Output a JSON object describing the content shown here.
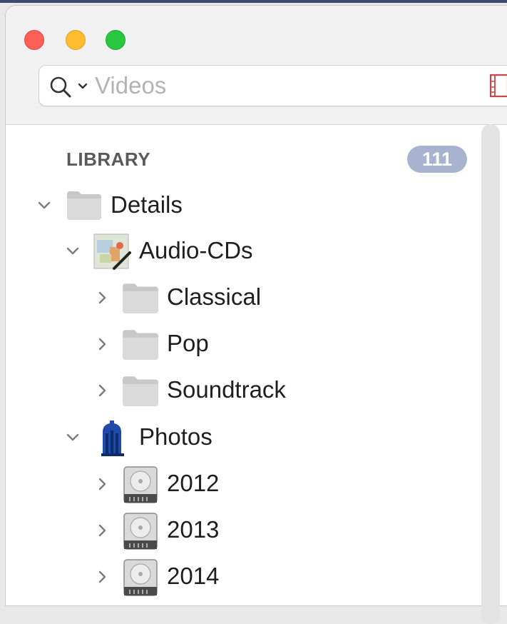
{
  "window": {
    "buttons": [
      "close",
      "minimize",
      "zoom"
    ]
  },
  "search": {
    "placeholder": "Videos",
    "icon": "search-icon",
    "scope_icon": "chevron-down-icon",
    "trailing_icon": "film-icon"
  },
  "sidebar": {
    "section_title": "LIBRARY",
    "count": "111",
    "items": [
      {
        "label": "Details",
        "icon": "folder-icon",
        "expanded": true,
        "level": 0
      },
      {
        "label": "Audio-CDs",
        "icon": "album-art-icon",
        "expanded": true,
        "level": 1
      },
      {
        "label": "Classical",
        "icon": "folder-icon",
        "expanded": false,
        "level": 2
      },
      {
        "label": "Pop",
        "icon": "folder-icon",
        "expanded": false,
        "level": 2
      },
      {
        "label": "Soundtrack",
        "icon": "folder-icon",
        "expanded": false,
        "level": 2
      },
      {
        "label": "Photos",
        "icon": "building-icon",
        "expanded": true,
        "level": 1
      },
      {
        "label": "2012",
        "icon": "hard-drive-icon",
        "expanded": false,
        "level": 2
      },
      {
        "label": "2013",
        "icon": "hard-drive-icon",
        "expanded": false,
        "level": 2
      },
      {
        "label": "2014",
        "icon": "hard-drive-icon",
        "expanded": false,
        "level": 2
      }
    ]
  },
  "colors": {
    "close": "#fe5f57",
    "minimize": "#febc2e",
    "zoom": "#28c840",
    "badge": "#a7b3cf"
  }
}
